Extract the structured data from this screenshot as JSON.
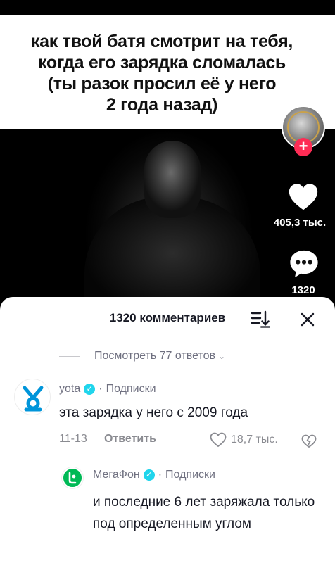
{
  "video": {
    "caption_lines": [
      "как твой батя смотрит на тебя,",
      "когда его зарядка сломалась",
      "(ты разок просил её у него",
      "2 года назад)"
    ],
    "follow_label": "+",
    "likes_count": "405,3 тыс.",
    "comments_count": "1320"
  },
  "sheet": {
    "title": "1320 комментариев",
    "view_replies": "Посмотреть 77 ответов"
  },
  "comments": [
    {
      "user": "yota",
      "follow": "Подписки",
      "separator": "·",
      "text": "эта зарядка у него с 2009 года",
      "date": "11-13",
      "reply_label": "Ответить",
      "likes": "18,7 тыс."
    },
    {
      "user": "МегаФон",
      "follow": "Подписки",
      "separator": "·",
      "text": "и последние 6 лет заряжала только под определенным углом"
    }
  ],
  "colors": {
    "accent_red": "#fe2c55",
    "verified_blue": "#20d5ec",
    "yota_blue": "#0095da",
    "megafon_green": "#00b956"
  },
  "icons": [
    "heart-icon",
    "comment-icon",
    "sort-icon",
    "close-icon",
    "heart-outline-icon",
    "dislike-icon",
    "verified-icon",
    "chevron-down-icon"
  ]
}
